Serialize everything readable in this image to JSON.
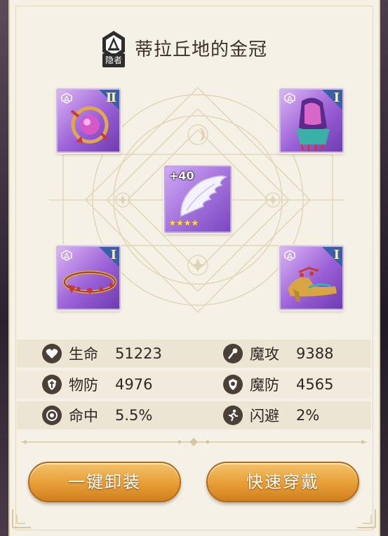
{
  "header": {
    "class_label": "隐者",
    "title": "蒂拉丘地的金冠"
  },
  "equipment": {
    "top_left": {
      "tier": "Ⅱ",
      "icon": "pendant-icon"
    },
    "top_right": {
      "tier": "Ⅰ",
      "icon": "gloves-icon"
    },
    "bottom_left": {
      "tier": "Ⅰ",
      "icon": "crown-circlet-icon"
    },
    "bottom_right": {
      "tier": "Ⅰ",
      "icon": "shoes-icon"
    },
    "center": {
      "enhance": "+40",
      "icon": "wing-icon",
      "stars": "★★★★",
      "star_count": 4
    }
  },
  "stats": [
    {
      "label": "生命",
      "value": "51223",
      "icon": "heart-icon"
    },
    {
      "label": "魔攻",
      "value": "9388",
      "icon": "wand-icon"
    },
    {
      "label": "物防",
      "value": "4976",
      "icon": "shield-sword-icon"
    },
    {
      "label": "魔防",
      "value": "4565",
      "icon": "magic-shield-icon"
    },
    {
      "label": "命中",
      "value": "5.5%",
      "icon": "target-icon"
    },
    {
      "label": "闪避",
      "value": "2%",
      "icon": "dodge-runner-icon"
    }
  ],
  "buttons": {
    "unequip_all": "一键卸装",
    "quick_equip": "快速穿戴"
  },
  "colors": {
    "panel": "#f6f1e6",
    "accent": "#e79e36",
    "slot_purple": "#9a5fd6",
    "tier_blue": "#3b5ea8"
  }
}
